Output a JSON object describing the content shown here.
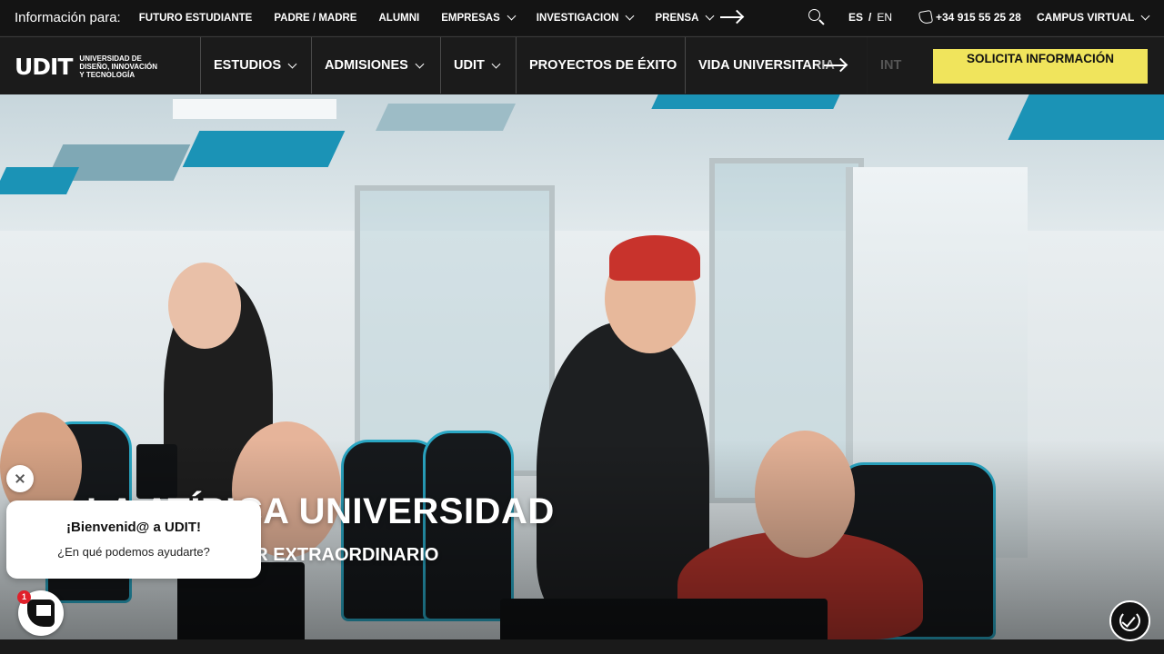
{
  "topbar": {
    "info_label": "Información para:",
    "links": [
      {
        "label": "FUTURO ESTUDIANTE",
        "has_dropdown": false
      },
      {
        "label": "PADRE / MADRE",
        "has_dropdown": false
      },
      {
        "label": "ALUMNI",
        "has_dropdown": false
      },
      {
        "label": "EMPRESAS",
        "has_dropdown": true
      },
      {
        "label": "INVESTIGACIÓN",
        "has_dropdown": true
      },
      {
        "label": "PRENSA",
        "has_dropdown": true
      }
    ],
    "lang_es": "ES",
    "lang_sep": "/",
    "lang_en": "EN",
    "phone": "+34 915 55 25 28",
    "campus": "CAMPUS VIRTUAL"
  },
  "logo": {
    "mark": "UDIT",
    "text": "UNIVERSIDAD DE DISEÑO, INNOVACIÓN Y TECNOLOGÍA"
  },
  "nav": {
    "items": [
      {
        "label": "ESTUDIOS",
        "has_dropdown": true
      },
      {
        "label": "ADMISIONES",
        "has_dropdown": true
      },
      {
        "label": "UDIT",
        "has_dropdown": true
      },
      {
        "label": "PROYECTOS DE ÉXITO",
        "has_dropdown": false
      },
      {
        "label": "VIDA UNIVERSITARIA",
        "has_dropdown": false
      },
      {
        "label": "INT",
        "has_dropdown": false
      }
    ],
    "cta": "SOLICITA INFORMACIÓN"
  },
  "hero": {
    "title": "LA ATÍPICA UNIVERSIDAD",
    "subtitle": "LO NORMAL ES SER EXTRAORDINARIO"
  },
  "chat": {
    "title": "¡Bienvenid@ a UDIT!",
    "text": "¿En qué podemos ayudarte?",
    "badge": "1"
  },
  "colors": {
    "cta_bg": "#f0e45c",
    "bar_bg": "#141414",
    "accent_teal": "#1b93b6"
  }
}
